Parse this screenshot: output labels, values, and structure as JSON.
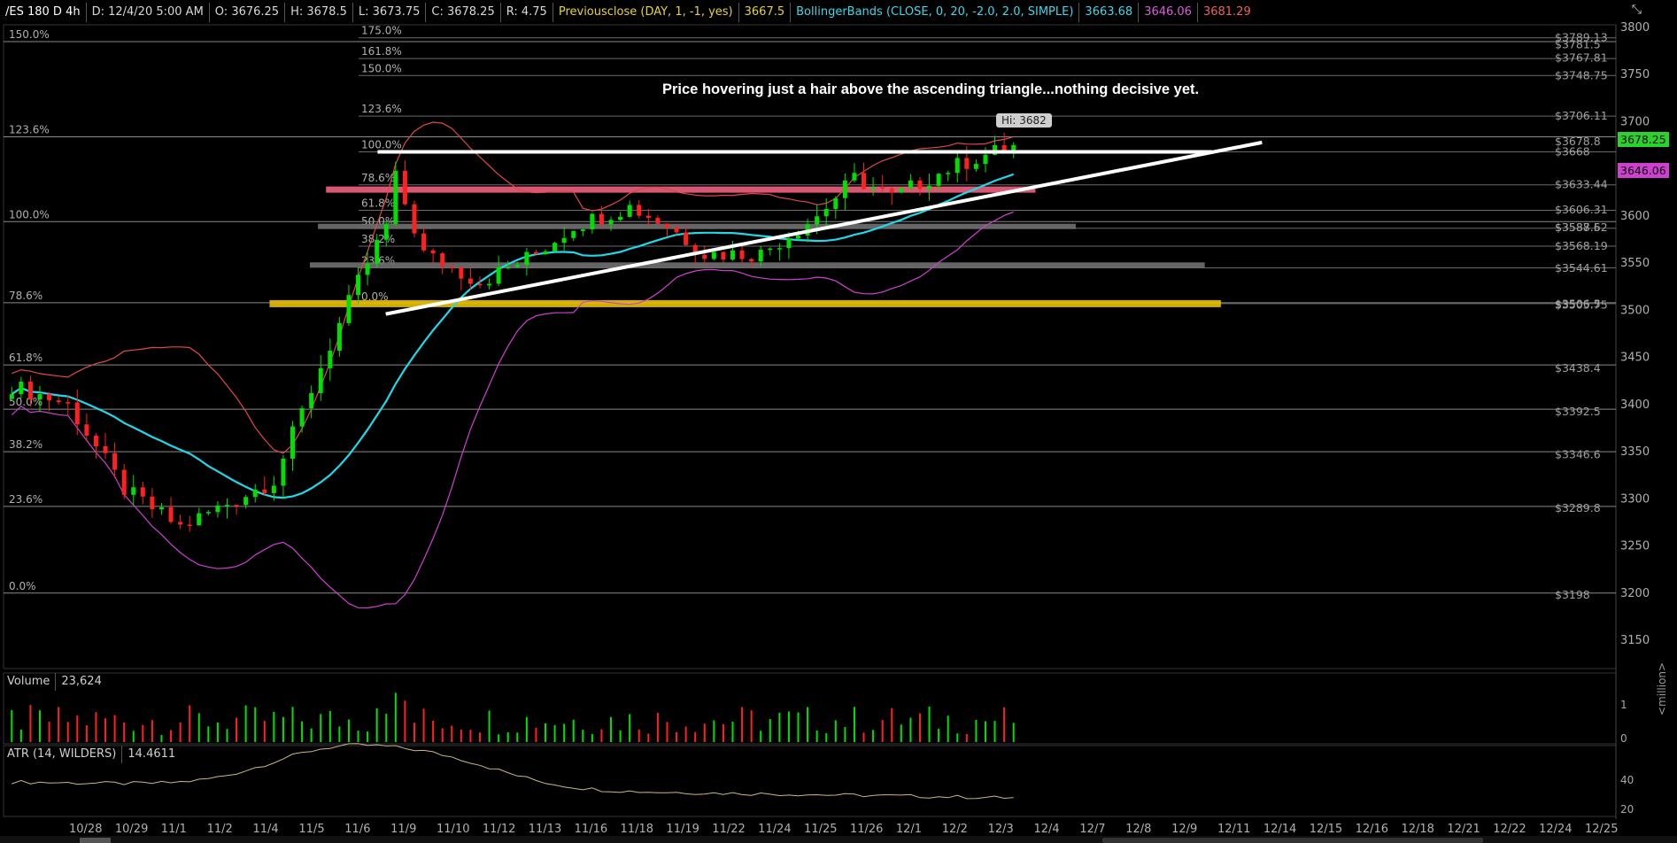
{
  "header": {
    "symbol": "/ES 180 D 4h",
    "date": "D: 12/4/20 5:00 AM",
    "open": "O: 3676.25",
    "high": "H: 3678.5",
    "low": "L: 3673.75",
    "close": "C: 3678.25",
    "range": "R: 4.75",
    "prevclose_label": "Previousclose (DAY, 1, -1, yes)",
    "prevclose_value": "3667.5",
    "bb_label": "BollingerBands (CLOSE, 0, 20, -2.0, 2.0, SIMPLE)",
    "bb_mid": "3663.68",
    "bb_low": "3646.06",
    "bb_up": "3681.29"
  },
  "annotation": "Price hovering just a hair above the ascending triangle...nothing decisive yet.",
  "hi_label": "Hi: 3682",
  "price_tags": {
    "last": "3678.25",
    "bb_low": "3646.06"
  },
  "volume_pane": {
    "title": "Volume",
    "value": "23,624",
    "axis_labels": [
      "1",
      "0"
    ],
    "y_axis_unit": "<million>"
  },
  "atr_pane": {
    "title": "ATR (14, WILDERS)",
    "value": "14.4611",
    "axis_labels": [
      "40",
      "20"
    ]
  },
  "colors": {
    "up": "#00e000",
    "down": "#ff2020",
    "bb_mid": "#20d8e8",
    "bb_low": "#d040d0",
    "bb_up": "#e04848",
    "atr": "#c8b88a",
    "yellow_zone": "#e8c000",
    "pink_zone": "#f06080"
  },
  "chart_data": {
    "type": "candlestick",
    "y_ticks": [
      3800,
      3750,
      3700,
      3650,
      3600,
      3550,
      3500,
      3450,
      3400,
      3350,
      3300,
      3250,
      3200,
      3150
    ],
    "x_labels": [
      "10/28",
      "10/29",
      "11/1",
      "11/2",
      "11/4",
      "11/5",
      "11/6",
      "11/9",
      "11/10",
      "11/12",
      "11/13",
      "11/16",
      "11/18",
      "11/19",
      "11/22",
      "11/24",
      "11/25",
      "11/26",
      "12/1",
      "12/2",
      "12/3",
      "12/4",
      "12/7",
      "12/8",
      "12/9",
      "12/11",
      "12/14",
      "12/15",
      "12/16",
      "12/18",
      "12/21",
      "12/22",
      "12/24",
      "12/25"
    ],
    "fib_left": [
      {
        "label": "150.0%",
        "price": 3785
      },
      {
        "label": "123.6%",
        "price": 3684
      },
      {
        "label": "100.0%",
        "price": 3594
      },
      {
        "label": "78.6%",
        "price": 3508
      },
      {
        "label": "61.8%",
        "price": 3442
      },
      {
        "label": "50.0%",
        "price": 3395
      },
      {
        "label": "38.2%",
        "price": 3350
      },
      {
        "label": "23.6%",
        "price": 3292
      },
      {
        "label": "0.0%",
        "price": 3200
      }
    ],
    "fib_mid": [
      {
        "label": "175.0%",
        "price": 3789
      },
      {
        "label": "161.8%",
        "price": 3767
      },
      {
        "label": "150.0%",
        "price": 3749
      },
      {
        "label": "123.6%",
        "price": 3706
      },
      {
        "label": "100.0%",
        "price": 3668
      },
      {
        "label": "78.6%",
        "price": 3633
      },
      {
        "label": "61.8%",
        "price": 3606
      },
      {
        "label": "50.0%",
        "price": 3587
      },
      {
        "label": "38.2%",
        "price": 3568
      },
      {
        "label": "23.6%",
        "price": 3545
      },
      {
        "label": "0.0%",
        "price": 3507
      }
    ],
    "right_levels": [
      {
        "label": "$3789.13",
        "price": 3789.13
      },
      {
        "label": "$3781.5",
        "price": 3781.5
      },
      {
        "label": "$3767.81",
        "price": 3767.81
      },
      {
        "label": "$3748.75",
        "price": 3748.75
      },
      {
        "label": "$3706.11",
        "price": 3706.11
      },
      {
        "label": "$3678.8",
        "price": 3678.8
      },
      {
        "label": "$3668",
        "price": 3668
      },
      {
        "label": "$3633.44",
        "price": 3633.44
      },
      {
        "label": "$3606.31",
        "price": 3606.31
      },
      {
        "label": "$3588.62",
        "price": 3587.5
      },
      {
        "label": "$3587.5",
        "price": 3587.5
      },
      {
        "label": "$3568.19",
        "price": 3568.19
      },
      {
        "label": "$3544.61",
        "price": 3544.61
      },
      {
        "label": "$3506.5",
        "price": 3506.5
      },
      {
        "label": "$3505.75",
        "price": 3505.75
      },
      {
        "label": "$3438.4",
        "price": 3438.4
      },
      {
        "label": "$3392.5",
        "price": 3392.5
      },
      {
        "label": "$3346.6",
        "price": 3346.6
      },
      {
        "label": "$3289.8",
        "price": 3289.8
      },
      {
        "label": "$3198",
        "price": 3198
      }
    ],
    "zones": [
      {
        "name": "pink",
        "price": 3628,
        "thick": 7,
        "x0": 0.2,
        "x1": 0.64,
        "color": "#f06080"
      },
      {
        "name": "gray-1",
        "price": 3589,
        "thick": 6,
        "x0": 0.195,
        "x1": 0.665,
        "color": "#707070"
      },
      {
        "name": "gray-2",
        "price": 3548,
        "thick": 6,
        "x0": 0.19,
        "x1": 0.745,
        "color": "#707070"
      },
      {
        "name": "yellow",
        "price": 3507,
        "thick": 8,
        "x0": 0.165,
        "x1": 0.755,
        "color": "#e8c000"
      }
    ],
    "resistance_line": {
      "price": 3668,
      "x0": 0.21,
      "x1": 0.755
    },
    "triangle_line": {
      "x0": 0.27,
      "p0": 3496,
      "x1": 0.775,
      "p1": 3678
    },
    "candles_count": 108
  }
}
